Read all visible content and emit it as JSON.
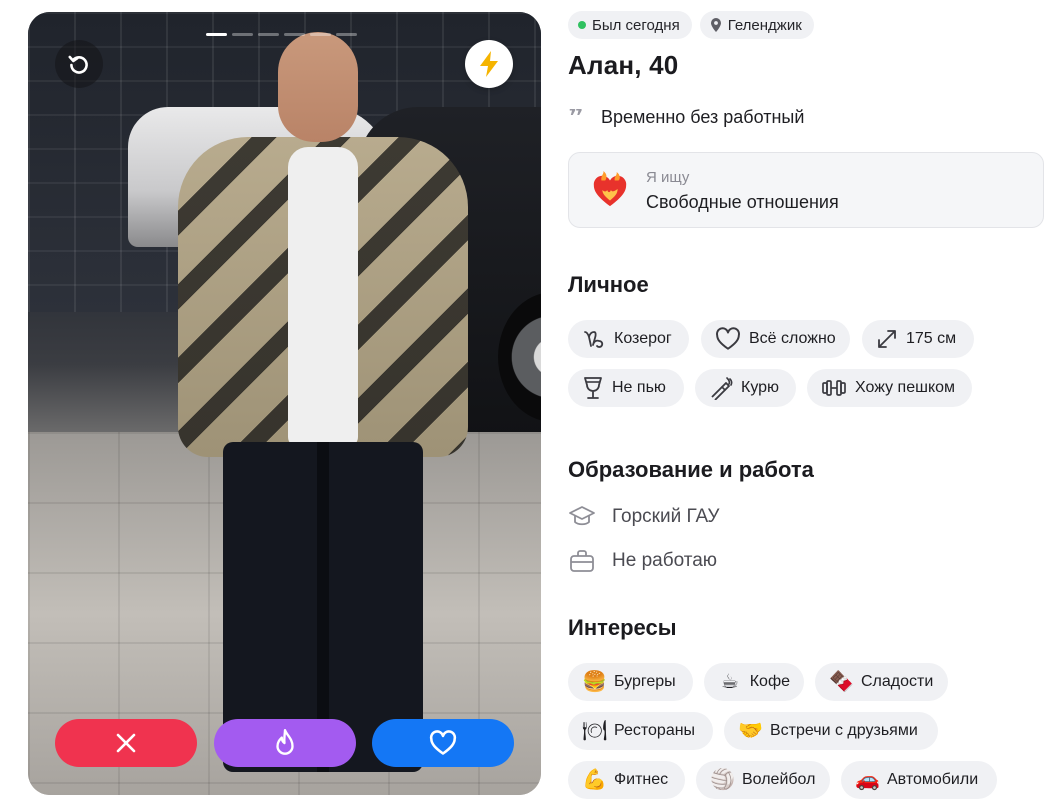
{
  "photo": {
    "progress_segments": 6,
    "active_segment": 1
  },
  "actions": {
    "dislike": "dislike",
    "superlike": "superlike",
    "like": "like"
  },
  "profile": {
    "status": "Был сегодня",
    "city": "Геленджик",
    "name_age": "Алан, 40",
    "about": "Временно без работный",
    "looking_for_title": "Я ищу",
    "looking_for_value": "Свободные отношения"
  },
  "personal": {
    "title": "Личное",
    "chips": [
      {
        "icon": "capricorn-icon",
        "label": "Козерог"
      },
      {
        "icon": "heart-outline-icon",
        "label": "Всё сложно"
      },
      {
        "icon": "height-icon",
        "label": "175 см"
      },
      {
        "icon": "wine-glass-icon",
        "label": "Не пью"
      },
      {
        "icon": "cigarette-icon",
        "label": "Курю"
      },
      {
        "icon": "dumbbell-icon",
        "label": "Хожу пешком"
      }
    ]
  },
  "education": {
    "title": "Образование и работа",
    "school": "Горский ГАУ",
    "job": "Не работаю"
  },
  "interests": {
    "title": "Интересы",
    "chips": [
      {
        "emoji": "🍔",
        "label": "Бургеры"
      },
      {
        "emoji": "☕",
        "label": "Кофе"
      },
      {
        "emoji": "🍫",
        "label": "Сладости"
      },
      {
        "emoji": "🍽",
        "label": "Рестораны"
      },
      {
        "emoji": "🤝",
        "label": "Встречи с друзьями"
      },
      {
        "emoji": "💪",
        "label": "Фитнес"
      },
      {
        "emoji": "🏐",
        "label": "Волейбол"
      },
      {
        "emoji": "🚗",
        "label": "Автомобили"
      }
    ]
  },
  "colors": {
    "dislike": "#f0334f",
    "superlike": "#a35bf0",
    "like": "#1477f5",
    "online": "#30c160",
    "boost": "#f5b400"
  }
}
